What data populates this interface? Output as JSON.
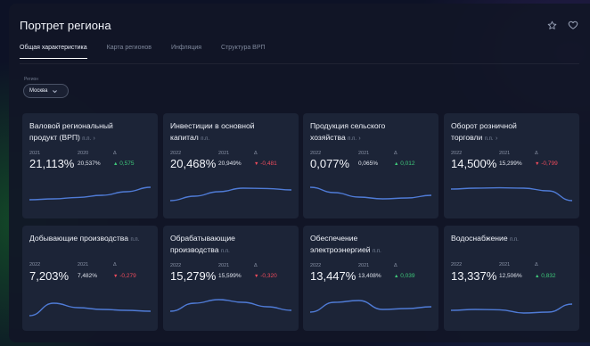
{
  "header": {
    "title": "Портрет региона",
    "star_icon": "star-icon",
    "heart_icon": "heart-icon"
  },
  "tabs": [
    {
      "label": "Общая характеристика",
      "active": true
    },
    {
      "label": "Карта регионов",
      "active": false
    },
    {
      "label": "Инфляция",
      "active": false
    },
    {
      "label": "Структура ВРП",
      "active": false
    }
  ],
  "region": {
    "label": "Регион",
    "value": "Москва"
  },
  "colors": {
    "up": "#3ec97a",
    "down": "#ee4b5c",
    "spark": "#4f7bd6"
  },
  "cards": [
    {
      "title1": "Валовой региональный",
      "title2": "продукт (ВРП)",
      "unit": "п.п.",
      "arrow": "›",
      "year_main": "2021",
      "year_prev": "2020",
      "delta_label": "Δ",
      "value": "21,113%",
      "prev": "20,537%",
      "delta": "0,575",
      "direction": "up",
      "trend": [
        0.15,
        0.2,
        0.28,
        0.4,
        0.6,
        0.85
      ]
    },
    {
      "title1": "Инвестиции в основной",
      "title2": "капитал",
      "unit": "п.п.",
      "arrow": "",
      "year_main": "2022",
      "year_prev": "2021",
      "delta_label": "Δ",
      "value": "20,468%",
      "prev": "20,949%",
      "delta": "-0,481",
      "direction": "down",
      "trend": [
        0.1,
        0.35,
        0.6,
        0.8,
        0.78,
        0.7
      ]
    },
    {
      "title1": "Продукция сельского",
      "title2": "хозяйства",
      "unit": "п.п.",
      "arrow": "›",
      "year_main": "2022",
      "year_prev": "2021",
      "delta_label": "Δ",
      "value": "0,077%",
      "prev": "0,065%",
      "delta": "0,012",
      "direction": "up",
      "trend": [
        0.85,
        0.55,
        0.3,
        0.2,
        0.25,
        0.4
      ]
    },
    {
      "title1": "Оборот розничной",
      "title2": "торговли",
      "unit": "п.п.",
      "arrow": "›",
      "year_main": "2022",
      "year_prev": "2021",
      "delta_label": "Δ",
      "value": "14,500%",
      "prev": "15,299%",
      "delta": "-0,799",
      "direction": "down",
      "trend": [
        0.75,
        0.8,
        0.82,
        0.8,
        0.65,
        0.1
      ]
    },
    {
      "title1": "Добывающие производства",
      "title2": "",
      "unit": "п.п.",
      "arrow": "",
      "year_main": "2022",
      "year_prev": "2021",
      "delta_label": "Δ",
      "value": "7,203%",
      "prev": "7,482%",
      "delta": "-0,279",
      "direction": "down",
      "trend": [
        0.15,
        0.85,
        0.6,
        0.5,
        0.45,
        0.4
      ]
    },
    {
      "title1": "Обрабатывающие",
      "title2": "производства",
      "unit": "п.п.",
      "arrow": "",
      "year_main": "2022",
      "year_prev": "2021",
      "delta_label": "Δ",
      "value": "15,279%",
      "prev": "15,599%",
      "delta": "-0,320",
      "direction": "down",
      "trend": [
        0.2,
        0.65,
        0.85,
        0.7,
        0.45,
        0.25
      ]
    },
    {
      "title1": "Обеспечение",
      "title2": "электроэнергией",
      "unit": "п.п.",
      "arrow": "",
      "year_main": "2022",
      "year_prev": "2021",
      "delta_label": "Δ",
      "value": "13,447%",
      "prev": "13,408%",
      "delta": "0,039",
      "direction": "up",
      "trend": [
        0.15,
        0.7,
        0.8,
        0.3,
        0.35,
        0.45
      ]
    },
    {
      "title1": "Водоснабжение",
      "title2": "",
      "unit": "п.п.",
      "arrow": "",
      "year_main": "2022",
      "year_prev": "2021",
      "delta_label": "Δ",
      "value": "13,337%",
      "prev": "12,506%",
      "delta": "0,832",
      "direction": "up",
      "trend": [
        0.45,
        0.5,
        0.48,
        0.3,
        0.35,
        0.8
      ]
    }
  ]
}
